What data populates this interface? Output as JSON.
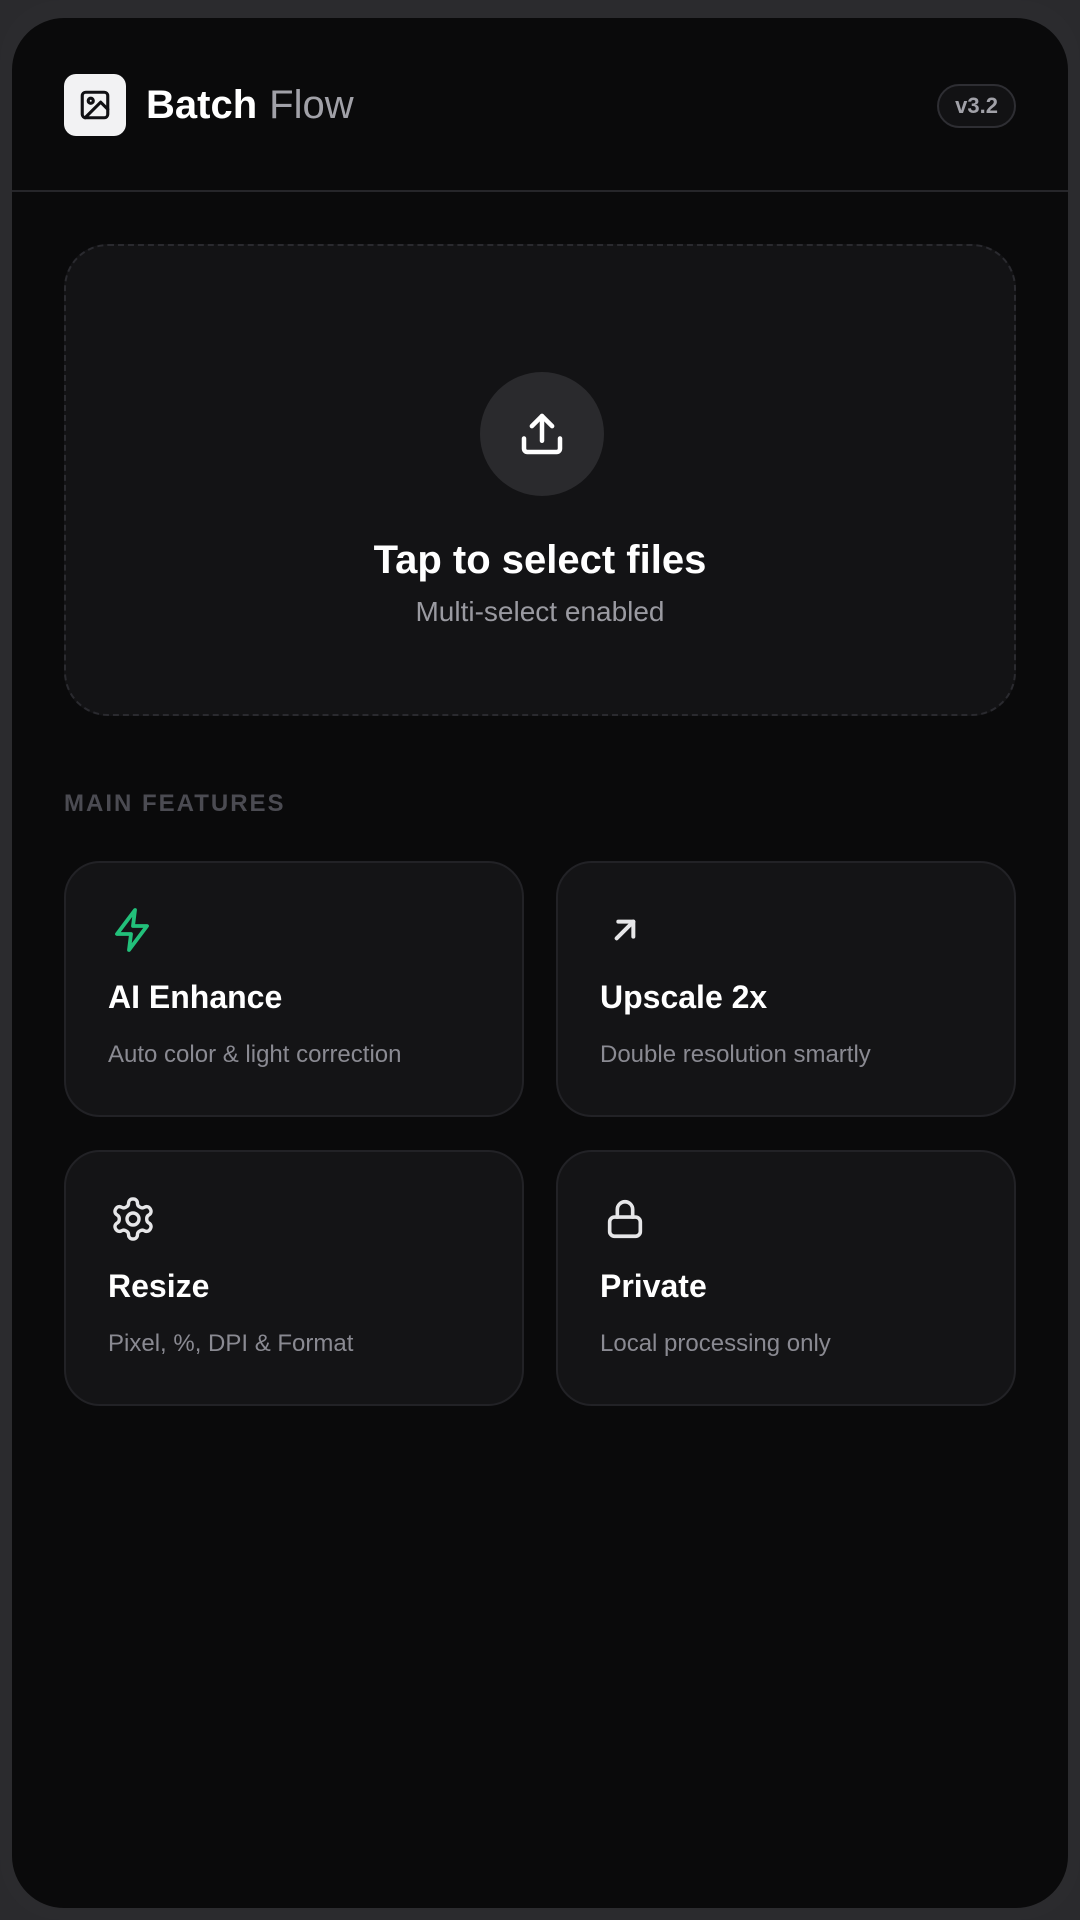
{
  "header": {
    "brand_main": "Batch",
    "brand_sub": "Flow",
    "version": "v3.2",
    "logo_icon": "image-icon"
  },
  "upload": {
    "icon": "upload-icon",
    "title": "Tap to select files",
    "subtitle": "Multi-select enabled"
  },
  "features": {
    "section_label": "MAIN FEATURES",
    "items": [
      {
        "icon": "bolt-icon",
        "title": "AI Enhance",
        "desc": "Auto color & light correction",
        "icon_color": "#22c07a"
      },
      {
        "icon": "arrow-up-right-icon",
        "title": "Upscale 2x",
        "desc": "Double resolution smartly",
        "icon_color": "#e6e6e8"
      },
      {
        "icon": "gear-icon",
        "title": "Resize",
        "desc": "Pixel, %, DPI & Format",
        "icon_color": "#e6e6e8"
      },
      {
        "icon": "lock-icon",
        "title": "Private",
        "desc": "Local processing only",
        "icon_color": "#e6e6e8"
      }
    ]
  },
  "colors": {
    "background": "#0a0a0b",
    "card": "#141416",
    "accent_green": "#22c07a"
  }
}
